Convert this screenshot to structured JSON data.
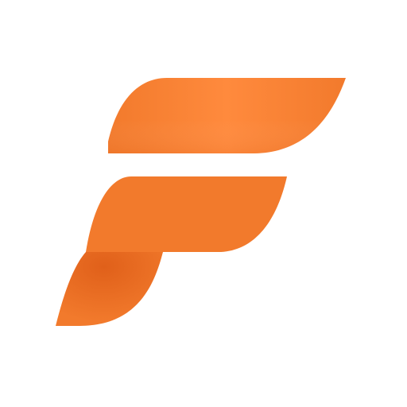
{
  "logo": {
    "icon": "letter-f-logo-icon",
    "colors": {
      "primary": "#F27A2C",
      "highlight": "#FF8A3D",
      "shadow": "#E0601A",
      "background": "#FFFFFF"
    }
  }
}
